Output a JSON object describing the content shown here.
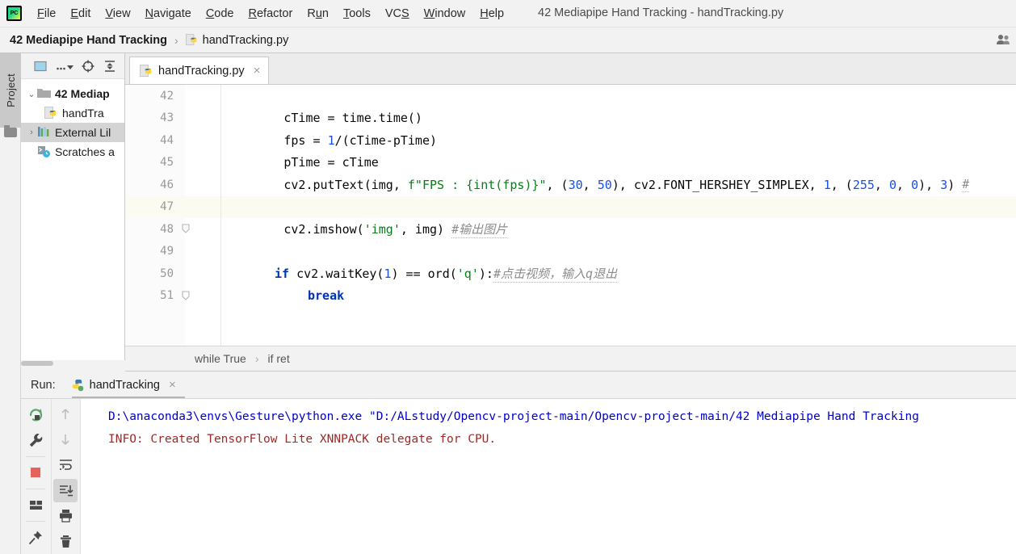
{
  "window": {
    "title": "42 Mediapipe Hand Tracking - handTracking.py",
    "logo_icon": "pycharm-logo-icon"
  },
  "menubar": {
    "items": [
      {
        "label": "File",
        "mnemonic": "F"
      },
      {
        "label": "Edit",
        "mnemonic": "E"
      },
      {
        "label": "View",
        "mnemonic": "V"
      },
      {
        "label": "Navigate",
        "mnemonic": "N"
      },
      {
        "label": "Code",
        "mnemonic": "C"
      },
      {
        "label": "Refactor",
        "mnemonic": "R"
      },
      {
        "label": "Run",
        "mnemonic": "u"
      },
      {
        "label": "Tools",
        "mnemonic": "T"
      },
      {
        "label": "VCS",
        "mnemonic": "S"
      },
      {
        "label": "Window",
        "mnemonic": "W"
      },
      {
        "label": "Help",
        "mnemonic": "H"
      }
    ]
  },
  "navbar": {
    "project": "42 Mediapipe Hand Tracking",
    "separator": "›",
    "file": "handTracking.py",
    "file_icon": "python-file-icon",
    "right_icon": "users-icon"
  },
  "sidebar": {
    "tool_tab_label": "Project",
    "tool_tab_icon": "folder-icon",
    "toolbar_icons": [
      "project-view-selector-icon",
      "dots-dropdown-icon",
      "locate-target-icon",
      "collapse-all-icon"
    ],
    "tree": [
      {
        "label": "42 Mediap",
        "chevron": "⌄",
        "icon": "folder-icon",
        "bold": true,
        "selected": false,
        "indent": 0
      },
      {
        "label": "handTra",
        "chevron": "",
        "icon": "python-file-icon",
        "bold": false,
        "selected": false,
        "indent": 1
      },
      {
        "label": "External Lil",
        "chevron": "›",
        "icon": "library-icon",
        "bold": false,
        "selected": true,
        "indent": 0
      },
      {
        "label": "Scratches a",
        "chevron": "",
        "icon": "scratches-icon",
        "bold": false,
        "selected": false,
        "indent": 0
      }
    ]
  },
  "editor": {
    "tab": {
      "label": "handTracking.py",
      "icon": "python-file-icon",
      "close": "×"
    },
    "first_line_number": 42,
    "lines": [
      {
        "n": 42,
        "fold": "",
        "highlight": false
      },
      {
        "n": 43,
        "fold": "",
        "highlight": false
      },
      {
        "n": 44,
        "fold": "",
        "highlight": false
      },
      {
        "n": 45,
        "fold": "",
        "highlight": false
      },
      {
        "n": 46,
        "fold": "",
        "highlight": false
      },
      {
        "n": 47,
        "fold": "",
        "highlight": true
      },
      {
        "n": 48,
        "fold": "fold",
        "highlight": false
      },
      {
        "n": 49,
        "fold": "",
        "highlight": false
      },
      {
        "n": 50,
        "fold": "",
        "highlight": false
      },
      {
        "n": 51,
        "fold": "fold",
        "highlight": false
      }
    ],
    "code": {
      "l43": "            cTime = time.time()",
      "l44_a": "            fps = ",
      "l44_n": "1",
      "l44_b": "/(cTime-pTime)",
      "l45": "            pTime = cTime",
      "l46_a": "            cv2.putText(img, ",
      "l46_str": "f\"FPS : {int(fps)}\"",
      "l46_b": ", (",
      "l46_n1": "30",
      "l46_c": ", ",
      "l46_n2": "50",
      "l46_d": "), cv2.FONT_HERSHEY_SIMPLEX, ",
      "l46_n3": "1",
      "l46_e": ", (",
      "l46_n4": "255",
      "l46_f": ", ",
      "l46_n5": "0",
      "l46_g": ", ",
      "l46_n6": "0",
      "l46_h": "), ",
      "l46_n7": "3",
      "l46_i": ") ",
      "l46_cmt": "#",
      "l48_a": "            cv2.imshow(",
      "l48_str": "'img'",
      "l48_b": ", img) ",
      "l48_cmt": "#输出图片",
      "l50_kw": "if",
      "l50_a": " cv2.waitKey(",
      "l50_n": "1",
      "l50_b": ") == ord(",
      "l50_str": "'q'",
      "l50_c": "):",
      "l50_cmt": "#点击视频，输入q退出",
      "l51_kw": "break"
    },
    "breadcrumb": {
      "items": [
        "while True",
        "if ret"
      ],
      "separator": "›"
    }
  },
  "run_tool_window": {
    "label": "Run:",
    "tab_label": "handTracking",
    "tab_icon": "python-run-icon",
    "tab_close": "×",
    "toolbar_left": [
      {
        "name": "rerun-icon",
        "color": "#59a869"
      },
      {
        "name": "wrench-icon",
        "color": "#4a4a4a"
      },
      {
        "name": "stop-icon",
        "color": "#e8625c"
      },
      {
        "name": "layout-icon",
        "color": "#4a4a4a"
      },
      {
        "name": "pin-icon",
        "color": "#4a4a4a"
      }
    ],
    "toolbar_right": [
      {
        "name": "up-arrow-icon",
        "color": "#bdbdbd",
        "active": false
      },
      {
        "name": "down-arrow-icon",
        "color": "#bdbdbd",
        "active": false
      },
      {
        "name": "soft-wrap-icon",
        "color": "#4a4a4a",
        "active": false
      },
      {
        "name": "scroll-to-end-icon",
        "color": "#4a4a4a",
        "active": true
      },
      {
        "name": "print-icon",
        "color": "#4a4a4a",
        "active": false
      },
      {
        "name": "trash-icon",
        "color": "#4a4a4a",
        "active": false
      }
    ],
    "console": [
      {
        "text": "D:\\anaconda3\\envs\\Gesture\\python.exe \"D:/ALstudy/Opencv-project-main/Opencv-project-main/42 Mediapipe Hand Tracking",
        "color": "#0000cc"
      },
      {
        "text": "INFO: Created TensorFlow Lite XNNPACK delegate for CPU.",
        "color": "#9e2927"
      }
    ]
  },
  "colors": {
    "keyword": "#0033b3",
    "number": "#1750eb",
    "string": "#067d17",
    "comment": "#8c8c8c",
    "console_command": "#0000cc",
    "console_info": "#9e2927",
    "caret_row": "#fcfbf2",
    "selection": "#d4d4d4"
  }
}
